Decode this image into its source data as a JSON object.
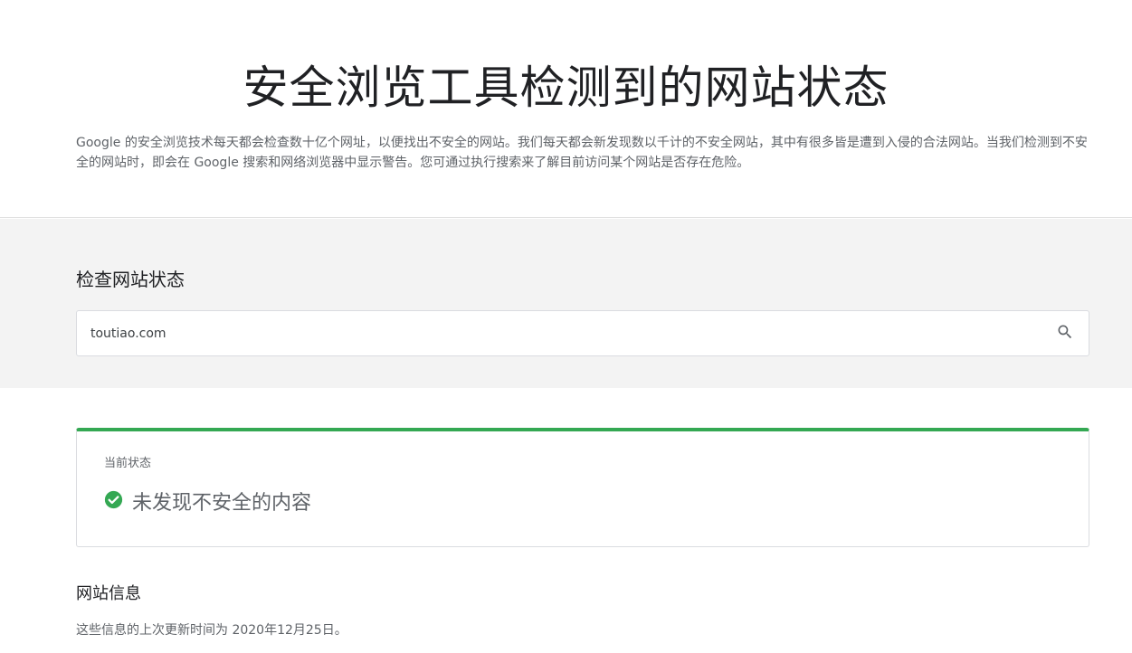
{
  "header": {
    "title": "安全浏览工具检测到的网站状态",
    "intro": "Google 的安全浏览技术每天都会检查数十亿个网址，以便找出不安全的网站。我们每天都会新发现数以千计的不安全网站，其中有很多皆是遭到入侵的合法网站。当我们检测到不安全的网站时，即会在 Google 搜索和网络浏览器中显示警告。您可通过执行搜索来了解目前访问某个网站是否存在危险。"
  },
  "search": {
    "heading": "检查网站状态",
    "value": "toutiao.com",
    "icon": "search-icon"
  },
  "status": {
    "label": "当前状态",
    "result": "未发现不安全的内容",
    "icon": "check-circle-icon",
    "accent_color": "#34a853"
  },
  "site_info": {
    "heading": "网站信息",
    "updated_text": "这些信息的上次更新时间为 2020年12月25日。"
  }
}
